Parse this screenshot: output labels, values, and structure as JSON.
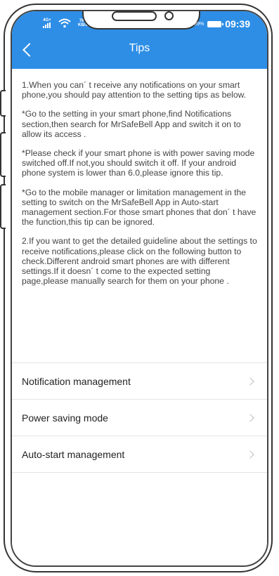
{
  "status_bar": {
    "signal_label": "4G+",
    "speed_top": "769",
    "speed_bottom": "KB/s",
    "battery_pct": "89%",
    "time": "09:39"
  },
  "header": {
    "title": "Tips"
  },
  "tips": [
    "1.When you can´ t receive any notifications on your smart phone,you should pay attention to the setting tips as below.",
    "*Go to the setting in your smart phone,find Notifications section,then search for MrSafeBell App and switch it on to allow its access .",
    "*Please check if your smart phone is with power saving mode switched off.If not,you should switch it off. If your android phone system is lower than 6.0,please ignore this tip.",
    "*Go to the mobile manager or limitation management in the setting to switch on the MrSafeBell App in Auto-start management section.For those smart phones that don´ t have the function,this tip can be ignored.",
    "2.If you want to get the detailed guideline about the settings to receive notifications,please click on the following button to check.Different android smart phones are with different settings.If it doesn´ t come to the expected setting page,please manually search for them on your phone ."
  ],
  "menu": [
    {
      "label": "Notification management"
    },
    {
      "label": "Power saving mode"
    },
    {
      "label": "Auto-start management"
    }
  ],
  "colors": {
    "accent": "#2e8ee6"
  }
}
